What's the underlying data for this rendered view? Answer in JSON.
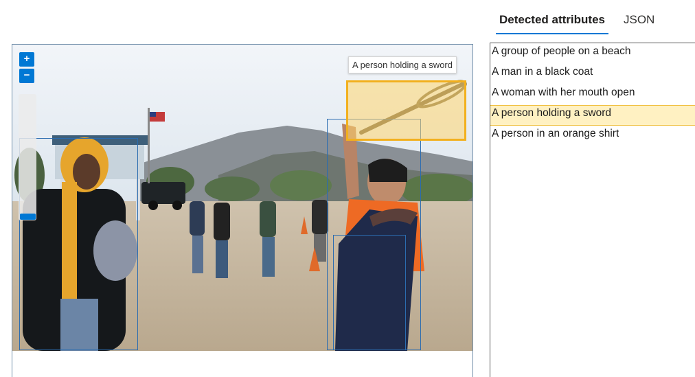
{
  "tabs": {
    "detected_label": "Detected attributes",
    "json_label": "JSON"
  },
  "viewer": {
    "zoom_in": "+",
    "zoom_out": "−",
    "zoom_level_fraction": 0.0,
    "tooltip": "A person holding a sword"
  },
  "attributes": [
    {
      "label": "A group of people on a beach",
      "selected": false
    },
    {
      "label": "A man in a black coat",
      "selected": false
    },
    {
      "label": "A woman with her mouth open",
      "selected": false
    },
    {
      "label": "A person holding a sword",
      "selected": true
    },
    {
      "label": "A person in an orange shirt",
      "selected": false
    }
  ],
  "colors": {
    "accent": "#0078d4",
    "highlight_border": "#f2b01e",
    "highlight_fill": "#fff1c2",
    "box_border": "#2b6cb0"
  }
}
